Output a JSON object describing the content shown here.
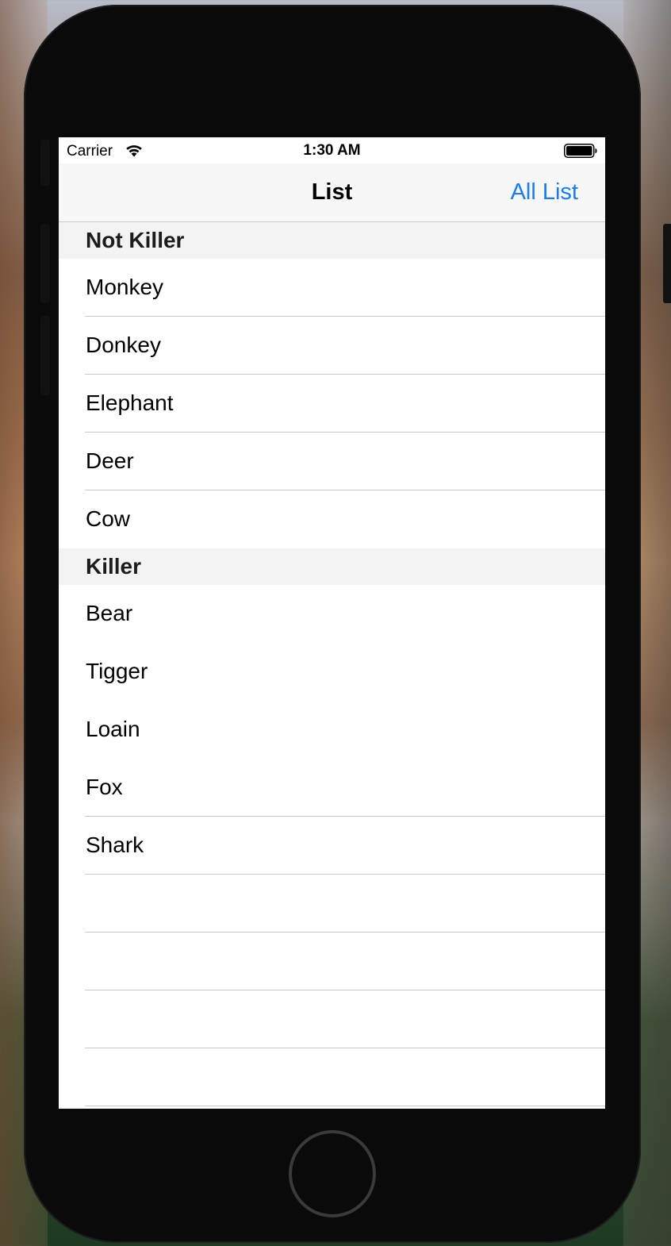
{
  "status_bar": {
    "carrier": "Carrier",
    "time": "1:30 AM",
    "wifi_icon": "wifi-icon",
    "battery_icon": "battery-icon"
  },
  "nav": {
    "title": "List",
    "right_button": "All List",
    "accent_color": "#1a7cf5"
  },
  "sections": [
    {
      "header": "Not Killer",
      "rows": [
        "Monkey",
        "Donkey",
        "Elephant",
        "Deer",
        "Cow"
      ]
    },
    {
      "header": "Killer",
      "rows": [
        "Bear",
        "Tigger",
        "Loain",
        "Fox",
        "Shark"
      ]
    }
  ],
  "device": {
    "home_button": "home-button"
  }
}
